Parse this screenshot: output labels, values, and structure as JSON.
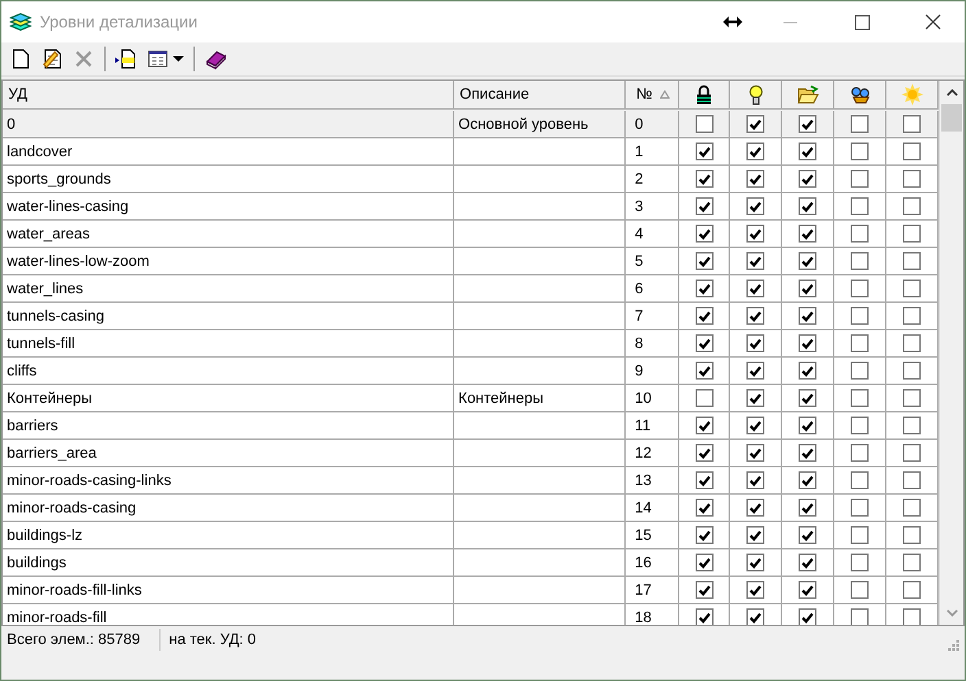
{
  "window": {
    "title": "Уровни детализации"
  },
  "toolbar": [
    {
      "kind": "new"
    },
    {
      "kind": "edit"
    },
    {
      "kind": "delete",
      "disabled": true
    },
    {
      "kind": "sep"
    },
    {
      "kind": "insert"
    },
    {
      "kind": "grid"
    },
    {
      "kind": "dropdown"
    },
    {
      "kind": "sep"
    },
    {
      "kind": "book"
    }
  ],
  "table": {
    "columns": [
      {
        "kind": "text",
        "label": "УД"
      },
      {
        "kind": "text",
        "label": "Описание"
      },
      {
        "kind": "number",
        "label": "№"
      },
      {
        "kind": "lock"
      },
      {
        "kind": "bulb"
      },
      {
        "kind": "folder"
      },
      {
        "kind": "binoculars"
      },
      {
        "kind": "sun"
      }
    ],
    "rows": [
      {
        "name": "0",
        "description": "Основной уровень",
        "number": "0",
        "selected": true,
        "checks": [
          false,
          true,
          true,
          false,
          false
        ]
      },
      {
        "name": "landcover",
        "number": "1",
        "selected": false,
        "checks": [
          true,
          true,
          true,
          false,
          false
        ]
      },
      {
        "name": "sports_grounds",
        "number": "2",
        "selected": false,
        "checks": [
          true,
          true,
          true,
          false,
          false
        ]
      },
      {
        "name": "water-lines-casing",
        "number": "3",
        "selected": false,
        "checks": [
          true,
          true,
          true,
          false,
          false
        ]
      },
      {
        "name": "water_areas",
        "number": "4",
        "selected": false,
        "checks": [
          true,
          true,
          true,
          false,
          false
        ]
      },
      {
        "name": "water-lines-low-zoom",
        "number": "5",
        "selected": false,
        "checks": [
          true,
          true,
          true,
          false,
          false
        ]
      },
      {
        "name": "water_lines",
        "number": "6",
        "selected": false,
        "checks": [
          true,
          true,
          true,
          false,
          false
        ]
      },
      {
        "name": "tunnels-casing",
        "number": "7",
        "selected": false,
        "checks": [
          true,
          true,
          true,
          false,
          false
        ]
      },
      {
        "name": "tunnels-fill",
        "number": "8",
        "selected": false,
        "checks": [
          true,
          true,
          true,
          false,
          false
        ]
      },
      {
        "name": "cliffs",
        "number": "9",
        "selected": false,
        "checks": [
          true,
          true,
          true,
          false,
          false
        ]
      },
      {
        "name": "Контейнеры",
        "description": "Контейнеры",
        "number": "10",
        "selected": false,
        "checks": [
          false,
          true,
          true,
          false,
          false
        ]
      },
      {
        "name": "barriers",
        "number": "11",
        "selected": false,
        "checks": [
          true,
          true,
          true,
          false,
          false
        ]
      },
      {
        "name": "barriers_area",
        "number": "12",
        "selected": false,
        "checks": [
          true,
          true,
          true,
          false,
          false
        ]
      },
      {
        "name": "minor-roads-casing-links",
        "number": "13",
        "selected": false,
        "checks": [
          true,
          true,
          true,
          false,
          false
        ]
      },
      {
        "name": "minor-roads-casing",
        "number": "14",
        "selected": false,
        "checks": [
          true,
          true,
          true,
          false,
          false
        ]
      },
      {
        "name": "buildings-lz",
        "number": "15",
        "selected": false,
        "checks": [
          true,
          true,
          true,
          false,
          false
        ]
      },
      {
        "name": "buildings",
        "number": "16",
        "selected": false,
        "checks": [
          true,
          true,
          true,
          false,
          false
        ]
      },
      {
        "name": "minor-roads-fill-links",
        "number": "17",
        "selected": false,
        "checks": [
          true,
          true,
          true,
          false,
          false
        ]
      },
      {
        "name": "minor-roads-fill",
        "number": "18",
        "selected": false,
        "checks": [
          true,
          true,
          true,
          false,
          false
        ]
      }
    ]
  },
  "status_bar": [
    "Всего элем.: 85789",
    "на тек. УД: 0"
  ]
}
